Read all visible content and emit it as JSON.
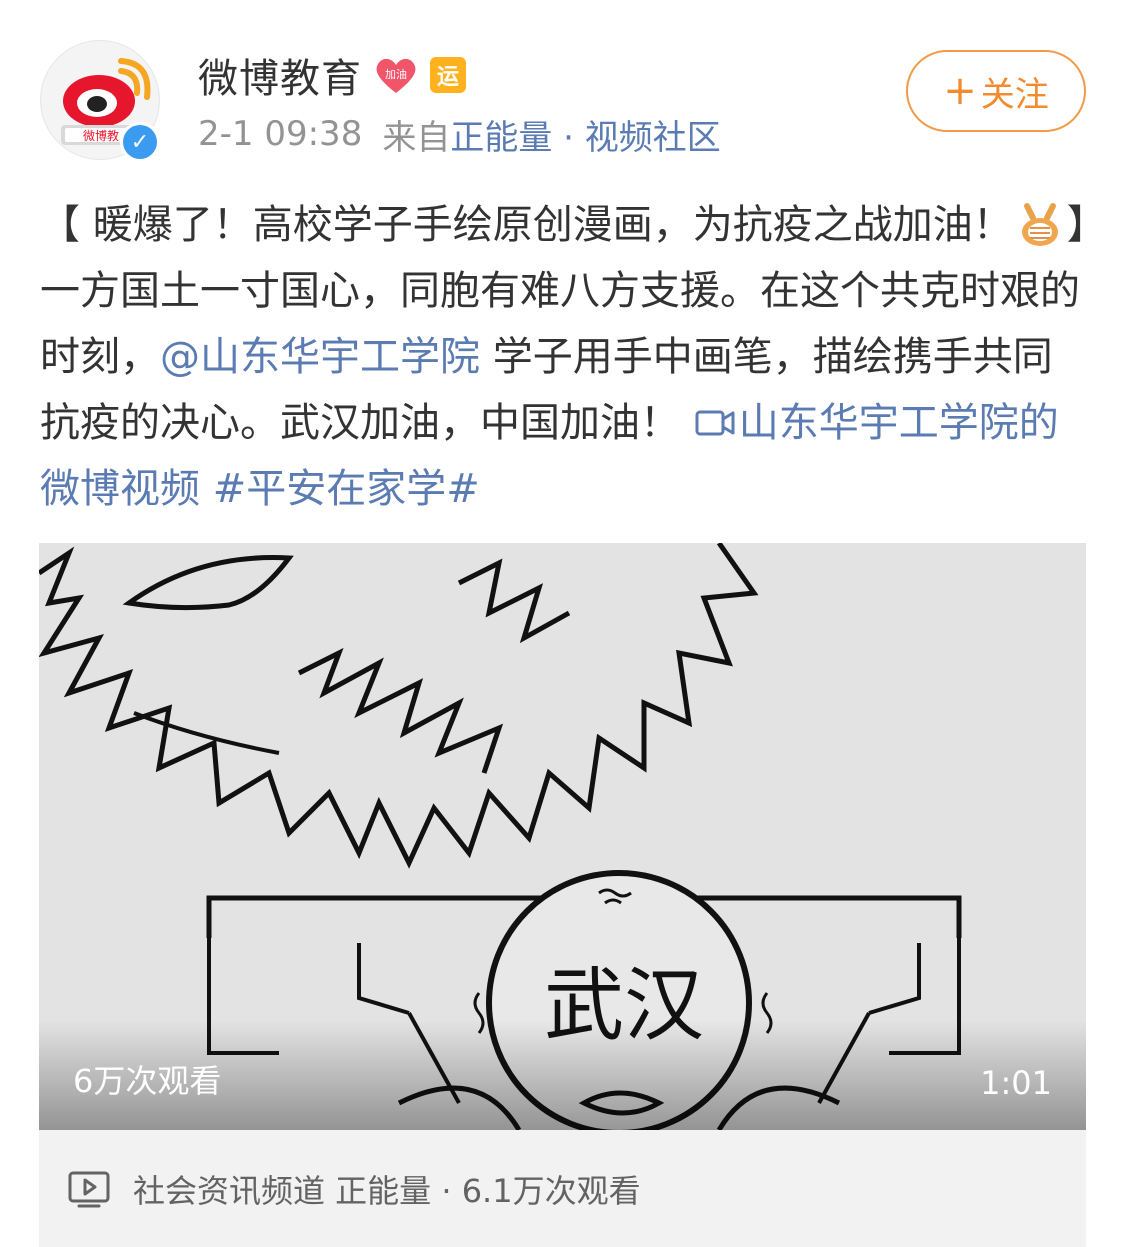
{
  "post": {
    "username": "微博教育",
    "badge_heart_text": "加油",
    "badge_yun_text": "运",
    "avatar_text": "微博教",
    "verified_mark": "✓",
    "time": "2-1 09:38",
    "from_prefix": "来自",
    "source": "正能量 · 视频社区",
    "follow_plus": "+",
    "follow_label": "关注"
  },
  "body": {
    "part1": "【 暖爆了！高校学子手绘原创漫画，为抗疫之战加油！",
    "part2": "】一方国土一寸国心，同胞有难八方支援。在这个共克时艰的时刻，",
    "mention": "@山东华宇工学院",
    "part3": " 学子用手中画笔，描绘携手共同抗疫的决心。武汉加油，中国加油！  ",
    "video_link": "山东华宇工学院的微博视频",
    "hashtag": " #平安在家学#"
  },
  "video": {
    "cartoon_text": "武汉",
    "views": "6万次观看",
    "duration": "1:01"
  },
  "video_card": {
    "channel": "社会资讯频道 正能量 · 6.1万次观看"
  },
  "colors": {
    "link": "#5b7bb3",
    "follow": "#f28a2e",
    "verified": "#3a9bf0",
    "badge_yun": "#ffb21d",
    "badge_heart": "#f1556a"
  }
}
